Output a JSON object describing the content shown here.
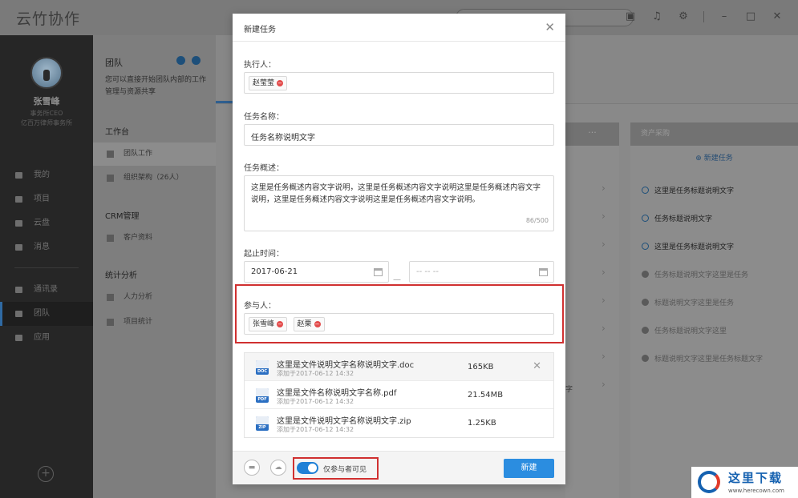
{
  "app": {
    "title": "云竹协作"
  },
  "user": {
    "name": "张雪峰",
    "role": "事务所CEO",
    "org": "亿百万律师事务所"
  },
  "leftnav": {
    "items": [
      {
        "label": "我的"
      },
      {
        "label": "项目"
      },
      {
        "label": "云盘"
      },
      {
        "label": "消息"
      },
      {
        "label": "通讯录"
      },
      {
        "label": "团队"
      },
      {
        "label": "应用"
      }
    ]
  },
  "subnav": {
    "title": "团队",
    "desc": "您可以直接开始团队内部的工作管理与资源共享",
    "sections": [
      {
        "title": "工作台",
        "items": [
          "团队工作",
          "组织架构（26人）"
        ]
      },
      {
        "title": "CRM管理",
        "items": [
          "客户资料"
        ]
      },
      {
        "title": "统计分析",
        "items": [
          "人力分析",
          "项目统计"
        ]
      }
    ]
  },
  "board": {
    "column_title": "资产采购",
    "column_more": "···",
    "add_task": "新建任务",
    "tasks": [
      "这里是任务标题说明文字",
      "任务标题说明文字",
      "这里是任务标题说明文字",
      "任务标题说明文字这里是任务",
      "标题说明文字这里是任务",
      "任务标题说明文字这里",
      "标题说明文字这里是任务标题文字"
    ],
    "left_col_fragment": "字"
  },
  "modal": {
    "title": "新建任务",
    "executor_label": "执行人：",
    "executors": [
      "赵莹莹"
    ],
    "task_name_label": "任务名称：",
    "task_name_value": "任务名称说明文字",
    "summary_label": "任务概述：",
    "summary_value": "这里是任务概述内容文字说明，这里是任务概述内容文字说明这里是任务概述内容文字说明，这里是任务概述内容文字说明这里是任务概述内容文字说明。",
    "summary_counter": "86/500",
    "date_label": "起止时间：",
    "start_date": "2017-06-21",
    "date_separator": "—",
    "end_date_placeholder": "-- -- --",
    "participants_label": "参与人：",
    "participants": [
      "张雪峰",
      "赵栗"
    ],
    "files": [
      {
        "name": "这里是文件说明文字名称说明文字.doc",
        "date": "添加于2017-06-12 14:32",
        "size": "165KB",
        "type": "DOC",
        "color": "#2b6fc2"
      },
      {
        "name": "这里是文件名称说明文字名称.pdf",
        "date": "添加于2017-06-12 14:32",
        "size": "21.54MB",
        "type": "PDF",
        "color": "#2b6fc2"
      },
      {
        "name": "这里是文件说明文字名称说明文字.zip",
        "date": "添加于2017-06-12 14:32",
        "size": "1.25KB",
        "type": "ZIP",
        "color": "#2b6fc2"
      }
    ],
    "visibility_label": "仅参与者可见",
    "create_button": "新建"
  },
  "watermark": {
    "text": "这里下载",
    "url": "www.herecown.com"
  },
  "colors": {
    "accent": "#2b8de0",
    "highlight": "#d03030",
    "remove": "#e34b4b"
  }
}
